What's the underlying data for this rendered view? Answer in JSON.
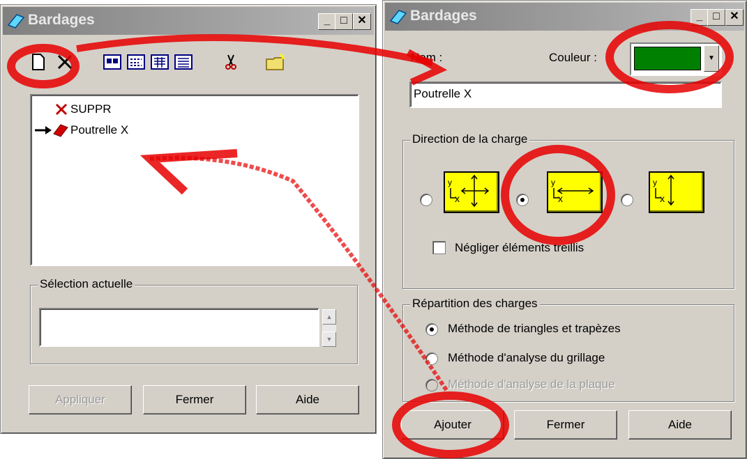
{
  "left_window": {
    "title": "Bardages",
    "toolbar_icons": [
      "new-document-icon",
      "delete-icon",
      "view1-icon",
      "view2-icon",
      "view3-icon",
      "view4-icon",
      "scissors-icon",
      "folder-new-icon"
    ],
    "list_items": [
      {
        "label": "SUPPR",
        "icon": "red-x-icon",
        "current": false
      },
      {
        "label": "Poutrelle X",
        "icon": "red-beam-icon",
        "current": true
      }
    ],
    "selection_legend": "Sélection actuelle",
    "selection_value": "",
    "buttons": {
      "apply": "Appliquer",
      "close": "Fermer",
      "help": "Aide"
    }
  },
  "right_window": {
    "title": "Bardages",
    "name_label": "Nom :",
    "name_value": "Poutrelle X",
    "color_label": "Couleur :",
    "color_value": "#008000",
    "direction_legend": "Direction de la charge",
    "direction_selected": 2,
    "neglect_label": "Négliger éléments treillis",
    "neglect_checked": false,
    "distribution_legend": "Répartition des charges",
    "methods": [
      {
        "label": "Méthode de triangles et trapèzes",
        "selected": true,
        "enabled": true
      },
      {
        "label": "Méthode d'analyse du grillage",
        "selected": false,
        "enabled": true
      },
      {
        "label": "Méthode d'analyse de la plaque",
        "selected": false,
        "enabled": false
      }
    ],
    "buttons": {
      "add": "Ajouter",
      "close": "Fermer",
      "help": "Aide"
    }
  },
  "axis_labels": {
    "y": "y",
    "x": "x"
  }
}
